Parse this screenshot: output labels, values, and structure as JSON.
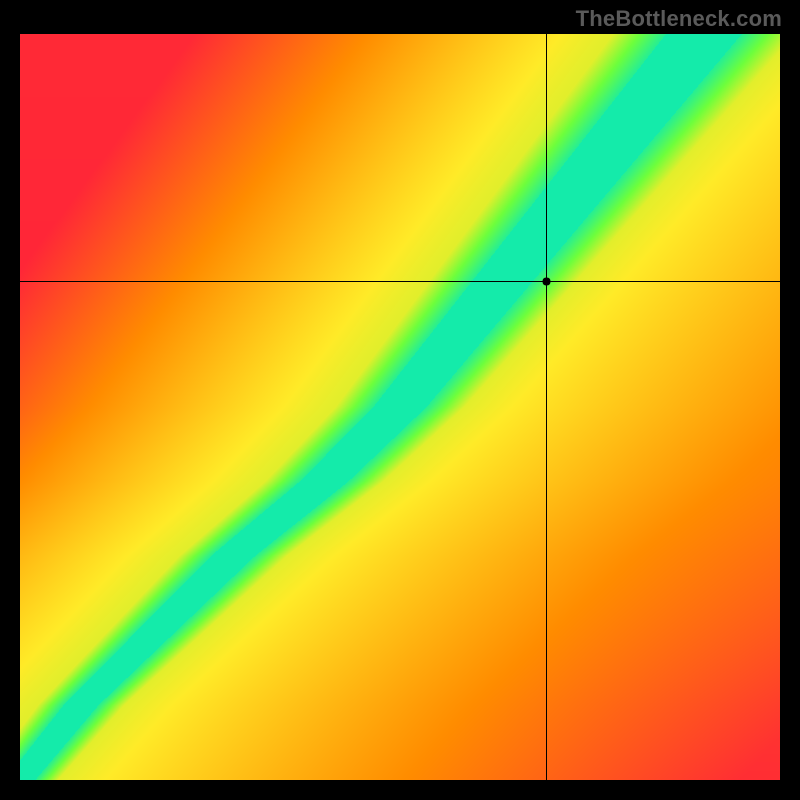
{
  "watermark": "TheBottleneck.com",
  "chart_data": {
    "type": "heatmap",
    "title": "",
    "xlabel": "",
    "ylabel": "",
    "xlim": [
      0,
      1
    ],
    "ylim": [
      0,
      1
    ],
    "crosshair": {
      "x": 0.693,
      "y": 0.668
    },
    "marker": {
      "x": 0.693,
      "y": 0.668,
      "radius": 4,
      "color": "#000000"
    },
    "colorscale": {
      "description": "red → orange → yellow → green → cyan along optimal ridge",
      "stops": [
        {
          "t": 0.0,
          "color": "#ff1744"
        },
        {
          "t": 0.25,
          "color": "#ff6d00"
        },
        {
          "t": 0.5,
          "color": "#ffeb3b"
        },
        {
          "t": 0.75,
          "color": "#76ff03"
        },
        {
          "t": 1.0,
          "color": "#1de9b6"
        }
      ]
    },
    "ridge": {
      "description": "approximate x-position of green optimal band as a function of y (both normalized 0..1)",
      "points": [
        {
          "y": 0.0,
          "x": 0.0
        },
        {
          "y": 0.1,
          "x": 0.08
        },
        {
          "y": 0.2,
          "x": 0.18
        },
        {
          "y": 0.3,
          "x": 0.28
        },
        {
          "y": 0.4,
          "x": 0.4
        },
        {
          "y": 0.5,
          "x": 0.5
        },
        {
          "y": 0.6,
          "x": 0.58
        },
        {
          "y": 0.7,
          "x": 0.66
        },
        {
          "y": 0.8,
          "x": 0.74
        },
        {
          "y": 0.9,
          "x": 0.82
        },
        {
          "y": 1.0,
          "x": 0.9
        }
      ],
      "core_halfwidth_base": 0.02,
      "core_halfwidth_top": 0.05,
      "yellow_halfwidth_base": 0.05,
      "yellow_halfwidth_top": 0.12
    },
    "corner_hints": {
      "top_left": "red",
      "top_right": "yellow",
      "bottom_left": "red",
      "bottom_right": "red"
    },
    "grid": false,
    "legend": false
  }
}
